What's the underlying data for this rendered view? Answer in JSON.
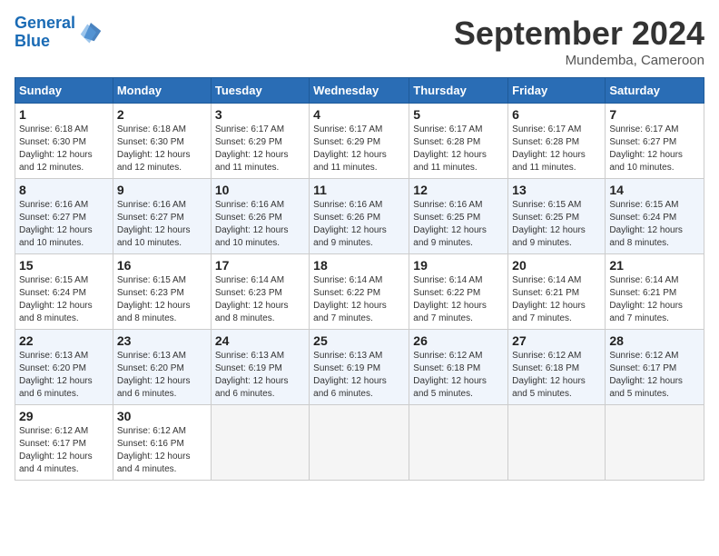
{
  "logo": {
    "line1": "General",
    "line2": "Blue"
  },
  "title": "September 2024",
  "location": "Mundemba, Cameroon",
  "days_header": [
    "Sunday",
    "Monday",
    "Tuesday",
    "Wednesday",
    "Thursday",
    "Friday",
    "Saturday"
  ],
  "weeks": [
    [
      {
        "num": "1",
        "info": "Sunrise: 6:18 AM\nSunset: 6:30 PM\nDaylight: 12 hours\nand 12 minutes."
      },
      {
        "num": "2",
        "info": "Sunrise: 6:18 AM\nSunset: 6:30 PM\nDaylight: 12 hours\nand 12 minutes."
      },
      {
        "num": "3",
        "info": "Sunrise: 6:17 AM\nSunset: 6:29 PM\nDaylight: 12 hours\nand 11 minutes."
      },
      {
        "num": "4",
        "info": "Sunrise: 6:17 AM\nSunset: 6:29 PM\nDaylight: 12 hours\nand 11 minutes."
      },
      {
        "num": "5",
        "info": "Sunrise: 6:17 AM\nSunset: 6:28 PM\nDaylight: 12 hours\nand 11 minutes."
      },
      {
        "num": "6",
        "info": "Sunrise: 6:17 AM\nSunset: 6:28 PM\nDaylight: 12 hours\nand 11 minutes."
      },
      {
        "num": "7",
        "info": "Sunrise: 6:17 AM\nSunset: 6:27 PM\nDaylight: 12 hours\nand 10 minutes."
      }
    ],
    [
      {
        "num": "8",
        "info": "Sunrise: 6:16 AM\nSunset: 6:27 PM\nDaylight: 12 hours\nand 10 minutes."
      },
      {
        "num": "9",
        "info": "Sunrise: 6:16 AM\nSunset: 6:27 PM\nDaylight: 12 hours\nand 10 minutes."
      },
      {
        "num": "10",
        "info": "Sunrise: 6:16 AM\nSunset: 6:26 PM\nDaylight: 12 hours\nand 10 minutes."
      },
      {
        "num": "11",
        "info": "Sunrise: 6:16 AM\nSunset: 6:26 PM\nDaylight: 12 hours\nand 9 minutes."
      },
      {
        "num": "12",
        "info": "Sunrise: 6:16 AM\nSunset: 6:25 PM\nDaylight: 12 hours\nand 9 minutes."
      },
      {
        "num": "13",
        "info": "Sunrise: 6:15 AM\nSunset: 6:25 PM\nDaylight: 12 hours\nand 9 minutes."
      },
      {
        "num": "14",
        "info": "Sunrise: 6:15 AM\nSunset: 6:24 PM\nDaylight: 12 hours\nand 8 minutes."
      }
    ],
    [
      {
        "num": "15",
        "info": "Sunrise: 6:15 AM\nSunset: 6:24 PM\nDaylight: 12 hours\nand 8 minutes."
      },
      {
        "num": "16",
        "info": "Sunrise: 6:15 AM\nSunset: 6:23 PM\nDaylight: 12 hours\nand 8 minutes."
      },
      {
        "num": "17",
        "info": "Sunrise: 6:14 AM\nSunset: 6:23 PM\nDaylight: 12 hours\nand 8 minutes."
      },
      {
        "num": "18",
        "info": "Sunrise: 6:14 AM\nSunset: 6:22 PM\nDaylight: 12 hours\nand 7 minutes."
      },
      {
        "num": "19",
        "info": "Sunrise: 6:14 AM\nSunset: 6:22 PM\nDaylight: 12 hours\nand 7 minutes."
      },
      {
        "num": "20",
        "info": "Sunrise: 6:14 AM\nSunset: 6:21 PM\nDaylight: 12 hours\nand 7 minutes."
      },
      {
        "num": "21",
        "info": "Sunrise: 6:14 AM\nSunset: 6:21 PM\nDaylight: 12 hours\nand 7 minutes."
      }
    ],
    [
      {
        "num": "22",
        "info": "Sunrise: 6:13 AM\nSunset: 6:20 PM\nDaylight: 12 hours\nand 6 minutes."
      },
      {
        "num": "23",
        "info": "Sunrise: 6:13 AM\nSunset: 6:20 PM\nDaylight: 12 hours\nand 6 minutes."
      },
      {
        "num": "24",
        "info": "Sunrise: 6:13 AM\nSunset: 6:19 PM\nDaylight: 12 hours\nand 6 minutes."
      },
      {
        "num": "25",
        "info": "Sunrise: 6:13 AM\nSunset: 6:19 PM\nDaylight: 12 hours\nand 6 minutes."
      },
      {
        "num": "26",
        "info": "Sunrise: 6:12 AM\nSunset: 6:18 PM\nDaylight: 12 hours\nand 5 minutes."
      },
      {
        "num": "27",
        "info": "Sunrise: 6:12 AM\nSunset: 6:18 PM\nDaylight: 12 hours\nand 5 minutes."
      },
      {
        "num": "28",
        "info": "Sunrise: 6:12 AM\nSunset: 6:17 PM\nDaylight: 12 hours\nand 5 minutes."
      }
    ],
    [
      {
        "num": "29",
        "info": "Sunrise: 6:12 AM\nSunset: 6:17 PM\nDaylight: 12 hours\nand 4 minutes."
      },
      {
        "num": "30",
        "info": "Sunrise: 6:12 AM\nSunset: 6:16 PM\nDaylight: 12 hours\nand 4 minutes."
      },
      {
        "num": "",
        "info": ""
      },
      {
        "num": "",
        "info": ""
      },
      {
        "num": "",
        "info": ""
      },
      {
        "num": "",
        "info": ""
      },
      {
        "num": "",
        "info": ""
      }
    ]
  ]
}
